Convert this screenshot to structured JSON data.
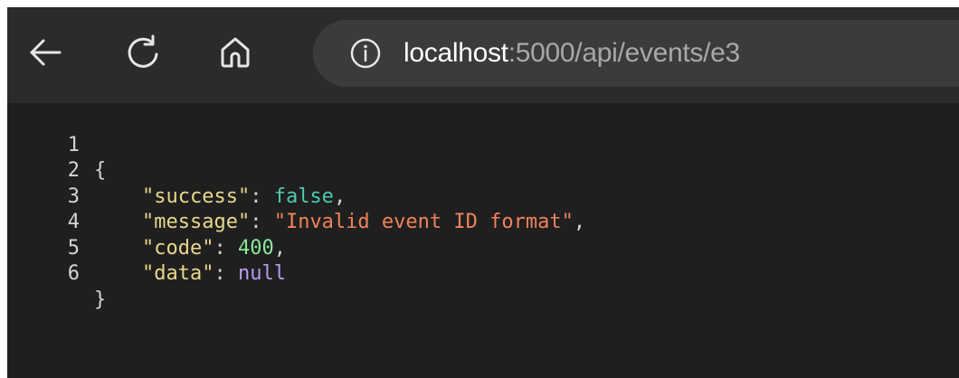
{
  "browser": {
    "nav": {
      "back_icon": "arrow-left-icon",
      "reload_icon": "reload-icon",
      "home_icon": "home-icon",
      "info_icon": "info-circle-icon"
    },
    "address": {
      "host": "localhost",
      "rest": ":5000/api/events/e3"
    }
  },
  "json_view": {
    "lines": [
      {
        "number": "1",
        "open": "{"
      },
      {
        "number": "2",
        "key": "\"success\"",
        "sep": ": ",
        "value": "false",
        "end": ","
      },
      {
        "number": "3",
        "key": "\"message\"",
        "sep": ": ",
        "value": "\"Invalid event ID format\"",
        "end": ","
      },
      {
        "number": "4",
        "key": "\"code\"",
        "sep": ": ",
        "value": "400",
        "end": ","
      },
      {
        "number": "5",
        "key": "\"data\"",
        "sep": ": ",
        "value": "null",
        "end": ""
      },
      {
        "number": "6",
        "close": "}"
      }
    ]
  },
  "colors": {
    "background": "#1f1f1f",
    "toolbar": "#2b2b2b",
    "omnibox": "#3b3b3b",
    "key": "#e8d88a",
    "boolean": "#4ec9b0",
    "string": "#f0825b",
    "number": "#89e89b",
    "null": "#b89cf0"
  }
}
